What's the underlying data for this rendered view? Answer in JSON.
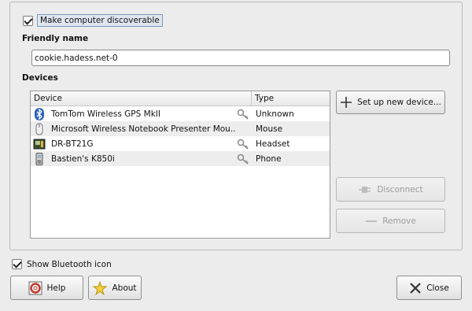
{
  "discoverable": {
    "label": "Make computer discoverable",
    "checked": true
  },
  "friendly_name": {
    "title": "Friendly name",
    "value": "cookie.hadess.net-0"
  },
  "devices": {
    "title": "Devices",
    "columns": [
      "Device",
      "Type"
    ],
    "rows": [
      {
        "name": "TomTom Wireless GPS MkII",
        "type": "Unknown",
        "icon": "bluetooth-icon",
        "paired_key": true
      },
      {
        "name": "Microsoft Wireless Notebook Presenter Mou...",
        "type": "Mouse",
        "icon": "mouse-icon",
        "paired_key": false
      },
      {
        "name": "DR-BT21G",
        "type": "Headset",
        "icon": "headset-device-icon",
        "paired_key": true
      },
      {
        "name": "Bastien's K850i",
        "type": "Phone",
        "icon": "phone-icon",
        "paired_key": true
      }
    ]
  },
  "buttons": {
    "setup": "Set up new device...",
    "disconnect": "Disconnect",
    "remove": "Remove",
    "help": "Help",
    "about": "About",
    "close": "Close"
  },
  "show_icon": {
    "label": "Show Bluetooth icon",
    "checked": true
  }
}
